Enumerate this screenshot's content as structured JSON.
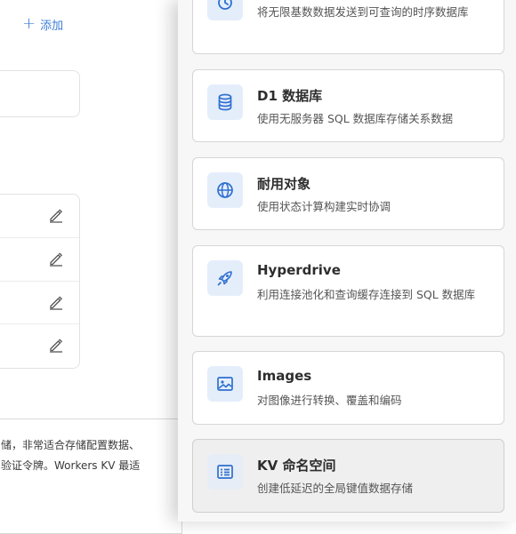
{
  "background_page": {
    "add_label": "添加",
    "tooltip_lines": [
      "储，非常适合存储配置数据、",
      "验证令牌。Workers KV 最适"
    ]
  },
  "drawer": {
    "cards": [
      {
        "title": "",
        "desc": "将无限基数数据发送到可查询的时序数据库",
        "icon": "analytics-icon"
      },
      {
        "title": "D1 数据库",
        "desc": "使用无服务器 SQL 数据库存储关系数据",
        "icon": "database-icon"
      },
      {
        "title": "耐用对象",
        "desc": "使用状态计算构建实时协调",
        "icon": "globe-icon"
      },
      {
        "title": "Hyperdrive",
        "desc": "利用连接池化和查询缓存连接到 SQL 数据库",
        "icon": "rocket-icon"
      },
      {
        "title": "Images",
        "desc": "对图像进行转换、覆盖和编码",
        "icon": "image-icon"
      },
      {
        "title": "KV 命名空间",
        "desc": "创建低延迟的全局键值数据存储",
        "icon": "kv-list-icon"
      }
    ]
  },
  "colors": {
    "accent": "#3f7ed8",
    "icon_bg": "#e4eefb",
    "selected_card_bg": "#efefef"
  }
}
